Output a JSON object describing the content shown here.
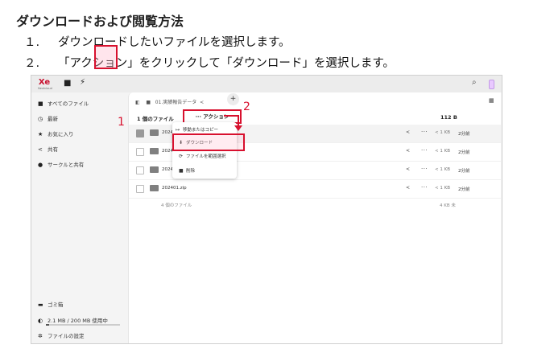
{
  "doc": {
    "title": "ダウンロードおよび閲覧方法",
    "steps": [
      {
        "num": "１.",
        "text": "ダウンロードしたいファイルを選択します。"
      },
      {
        "num": "２.",
        "text": "「アクション」をクリックして「ダウンロード」を選択します。"
      }
    ]
  },
  "app": {
    "logo_text": "Xe",
    "logo_sub": "Nextcloud",
    "sidebar": {
      "items": [
        {
          "icon": "■",
          "label": "すべてのファイル"
        },
        {
          "icon": "◷",
          "label": "最新"
        },
        {
          "icon": "★",
          "label": "お気に入り"
        },
        {
          "icon": "<",
          "label": "共有"
        },
        {
          "icon": "●",
          "label": "サークルと共有"
        }
      ],
      "trash": "ゴミ箱",
      "quota": "2.1 MB / 200 MB 使用中",
      "quota_fraction": 0.0105,
      "settings": "ファイルの設定"
    },
    "breadcrumbs": {
      "current": "01.実績報告データ",
      "share_glyph": "<",
      "plus": "+"
    },
    "header": {
      "selection": "1 個のファイル",
      "action_label": "··· アクション",
      "size_label": "112 B"
    },
    "rows": [
      {
        "name": "2024",
        "size": "< 1 KB",
        "time": "2分前",
        "selected": true
      },
      {
        "name": "2024",
        "size": "< 1 KB",
        "time": "2分前",
        "selected": false
      },
      {
        "name": "2024",
        "size": "< 1 KB",
        "time": "2分前",
        "selected": false
      },
      {
        "name": "202401.zip",
        "size": "< 1 KB",
        "time": "2分前",
        "selected": false
      }
    ],
    "summary": {
      "count": "4 個のファイル",
      "size": "4 KB 未"
    },
    "menu": {
      "items": [
        {
          "icon": "↦",
          "label": "移動またはコピー"
        },
        {
          "icon": "⬇",
          "label": "ダウンロード"
        },
        {
          "icon": "⟳",
          "label": "ファイルを範囲選択"
        },
        {
          "icon": "■",
          "label": "削除"
        }
      ]
    }
  },
  "annotations": {
    "one": "1",
    "two": "2"
  },
  "colors": {
    "accent": "#d8102e",
    "folder": "#808080"
  }
}
